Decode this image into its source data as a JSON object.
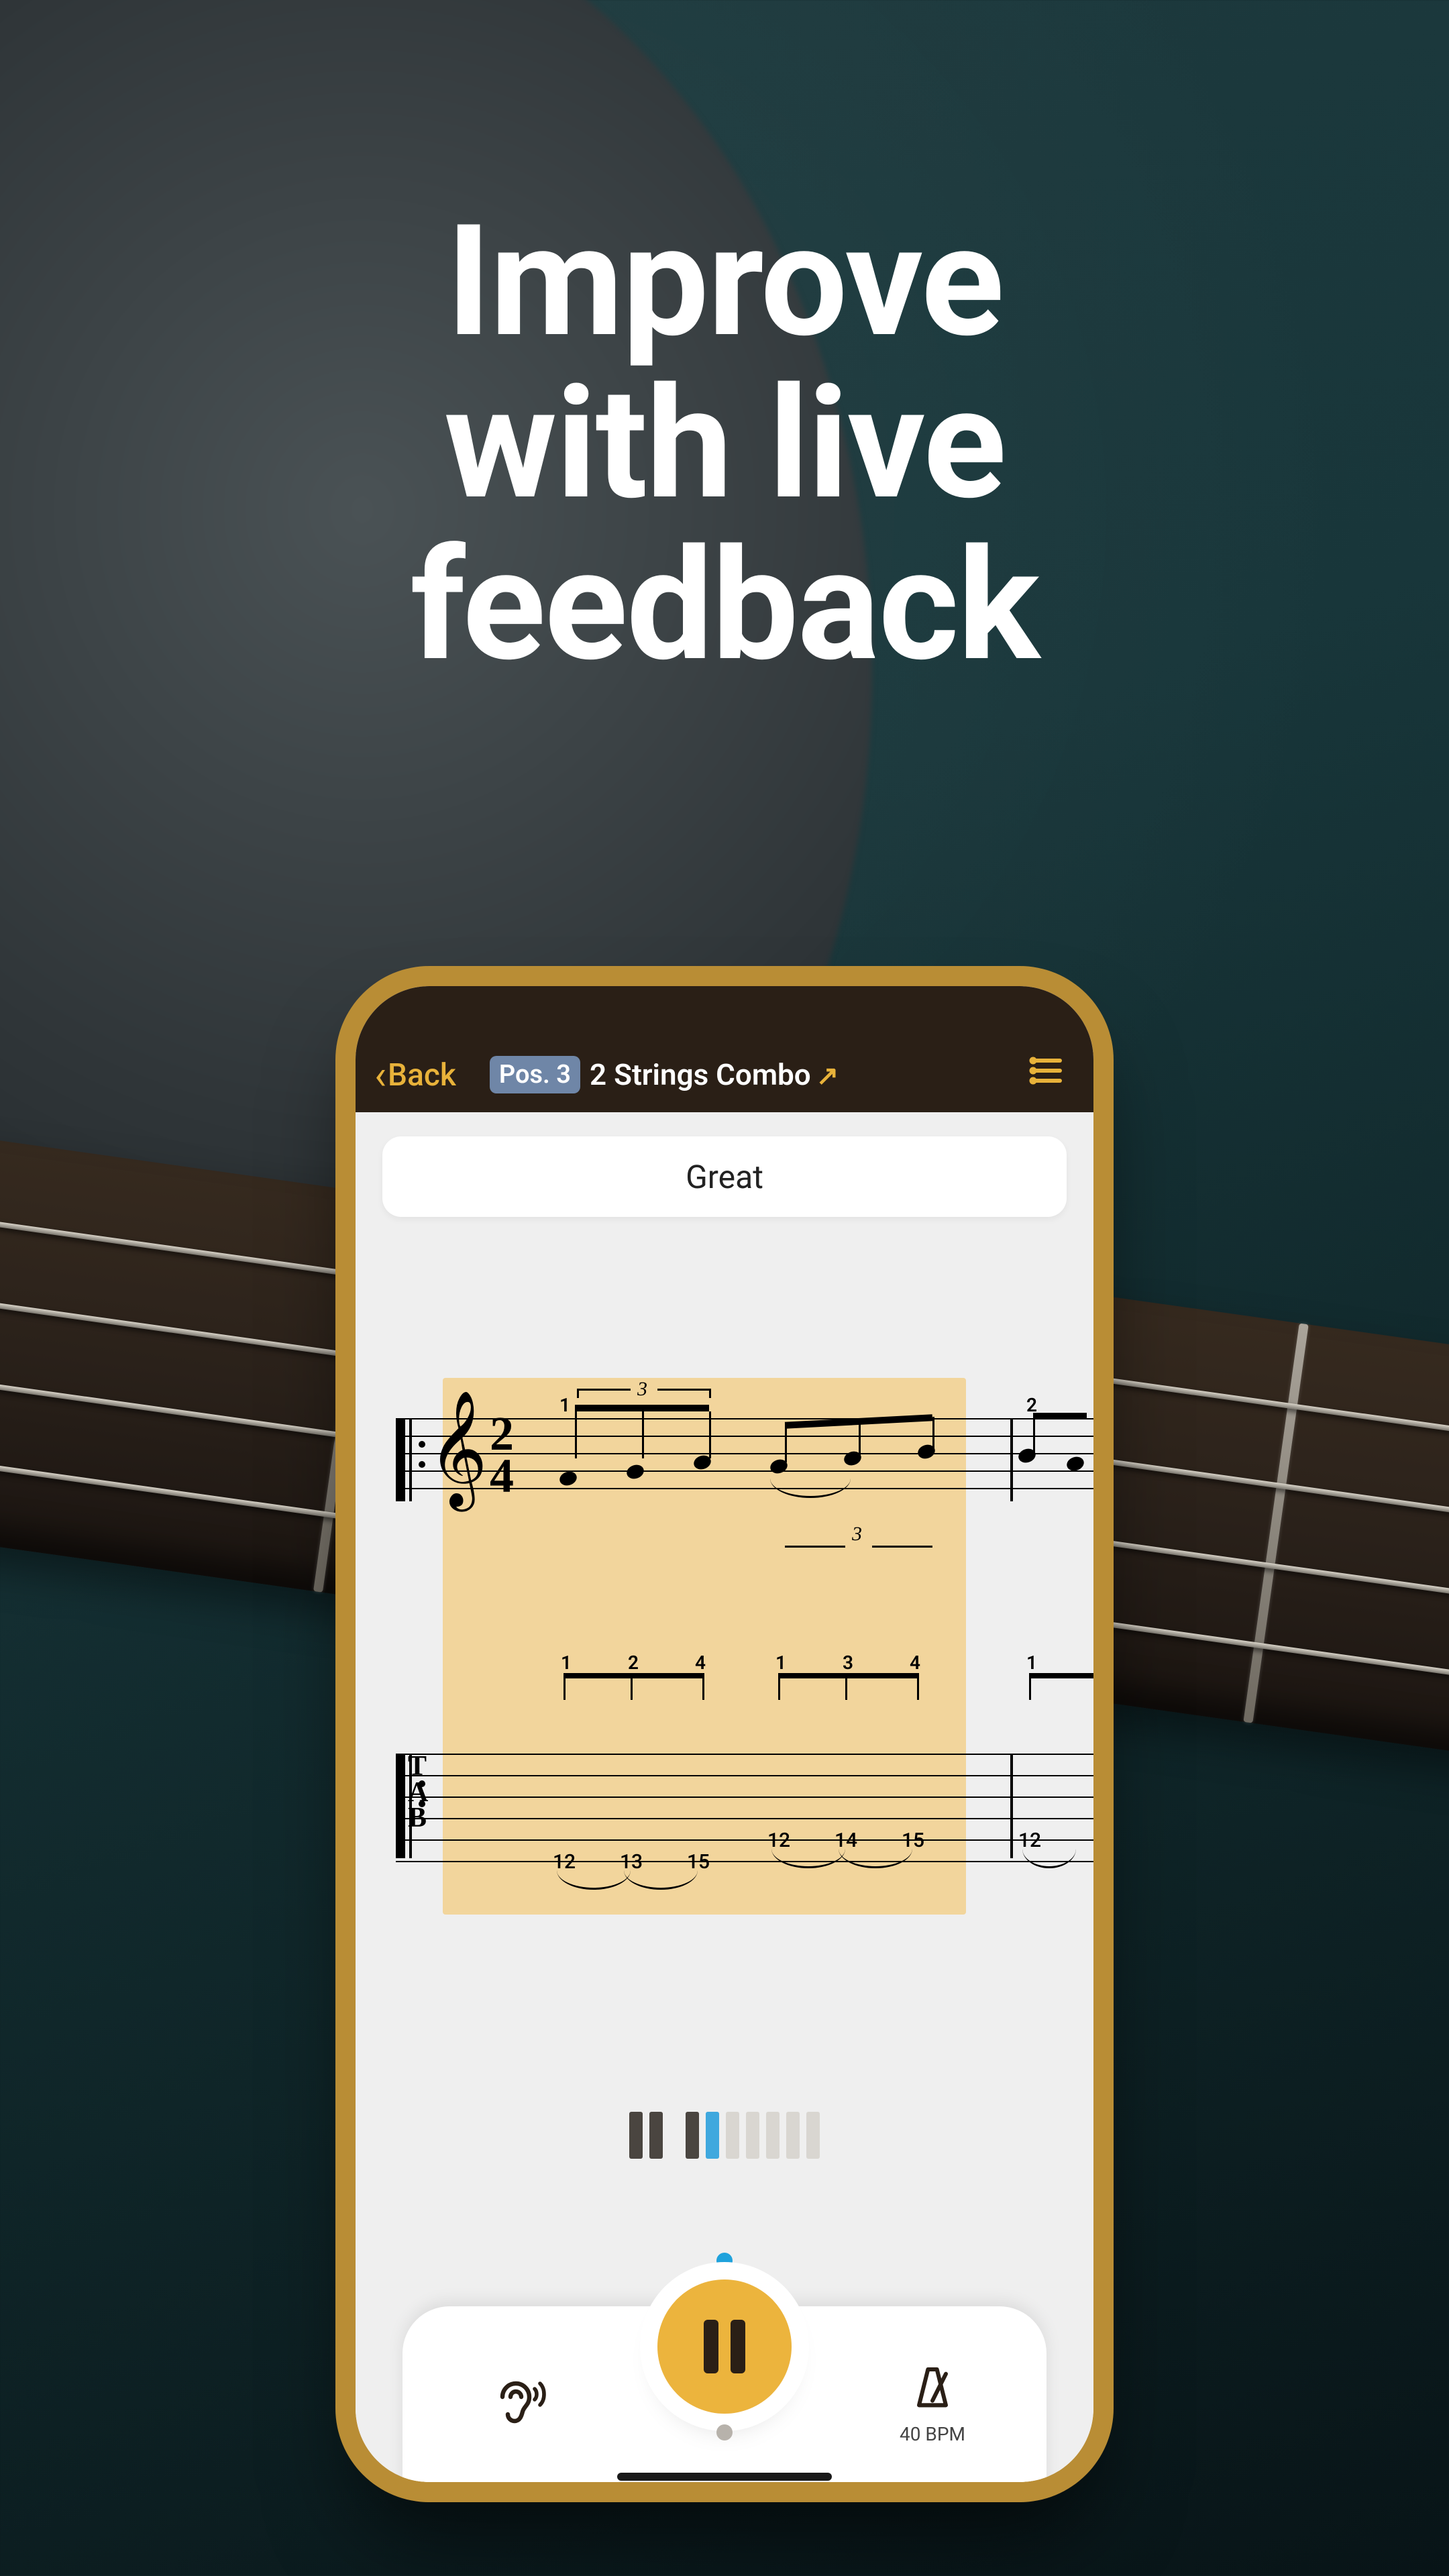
{
  "headline": "Improve\nwith live\nfeedback",
  "nav": {
    "back": "Back",
    "position_badge": "Pos. 3",
    "title": "2 Strings Combo",
    "arrow": "↗"
  },
  "feedback": "Great",
  "notation": {
    "time_top": "2",
    "time_bottom": "4",
    "tuplet": "3",
    "fingerings_measure1": [
      "1",
      "2",
      "4",
      "1",
      "3",
      "4"
    ],
    "fingerings_measure2_start": [
      "2",
      "1"
    ]
  },
  "tab": {
    "label_T": "T",
    "label_A": "A",
    "label_B": "B",
    "frets_measure1": [
      "12",
      "13",
      "15",
      "12",
      "14",
      "15"
    ],
    "frets_measure2_start": [
      "12"
    ]
  },
  "progress": {
    "states": [
      "done",
      "done",
      "gap",
      "done",
      "cur",
      "future",
      "future",
      "future",
      "future",
      "future"
    ]
  },
  "controls": {
    "bpm_label": "40 BPM"
  }
}
